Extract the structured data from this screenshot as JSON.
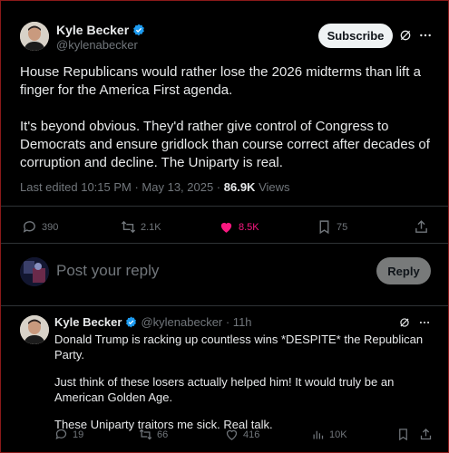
{
  "main_tweet": {
    "author_name": "Kyle Becker",
    "author_handle": "@kylenabecker",
    "subscribe_label": "Subscribe",
    "paragraph_1": "House Republicans would rather lose the 2026 midterms than lift a finger for the America First agenda.",
    "paragraph_2": "It's beyond obvious. They'd rather give control of Congress to Democrats and ensure gridlock than course correct after decades of corruption and decline. The Uniparty is real.",
    "edited_timestamp": "Last edited 10:15 PM · May 13, 2025 · ",
    "views_count": "86.9K",
    "views_label": " Views",
    "replies": "390",
    "reposts": "2.1K",
    "likes": "8.5K",
    "bookmarks": "75"
  },
  "reply_box": {
    "placeholder": "Post your reply",
    "reply_button": "Reply"
  },
  "reply_tweet": {
    "author_name": "Kyle Becker",
    "author_handle": "@kylenabecker · 11h",
    "line_1": "Donald Trump is racking up countless wins *DESPITE* the Republican Party.",
    "line_2": "Just think of these losers actually helped him! It would truly be an American Golden Age.",
    "line_3": "These Uniparty traitors me sick. Real talk.",
    "replies": "19",
    "reposts": "66",
    "likes": "416",
    "views": "10K"
  },
  "colors": {
    "background": "#000000",
    "text": "#e7e9ea",
    "muted": "#71767b",
    "verified": "#1d9bf0",
    "like": "#f91880"
  }
}
